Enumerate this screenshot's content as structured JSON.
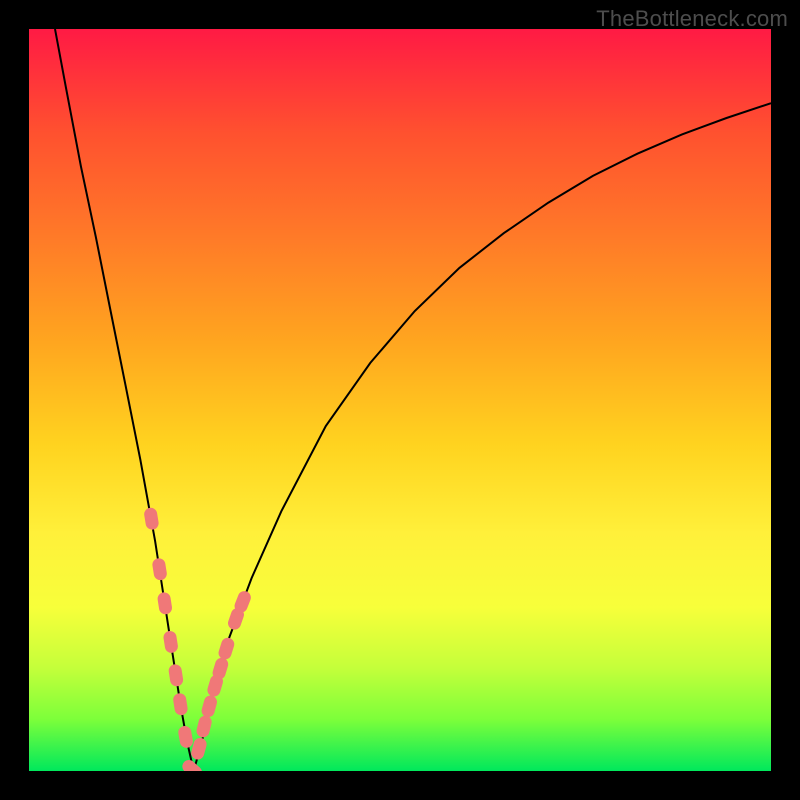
{
  "watermark": "TheBottleneck.com",
  "chart_data": {
    "type": "line",
    "title": "",
    "xlabel": "",
    "ylabel": "",
    "xlim": [
      0,
      100
    ],
    "ylim": [
      0,
      100
    ],
    "x_minimum": 22.2,
    "curve": {
      "x": [
        3.5,
        5,
        7,
        9,
        11,
        13,
        15,
        17,
        19,
        20.4,
        21.3,
        22.2,
        23.3,
        25,
        27,
        30,
        34,
        40,
        46,
        52,
        58,
        64,
        70,
        76,
        82,
        88,
        94,
        100
      ],
      "y": [
        100,
        92,
        81.5,
        72,
        62,
        52,
        42,
        31,
        18,
        9,
        4,
        0,
        4,
        11,
        18,
        26,
        35,
        46.5,
        55,
        62,
        67.8,
        72.5,
        76.6,
        80.2,
        83.2,
        85.8,
        88,
        90
      ]
    },
    "markers": {
      "x": [
        16.5,
        17.6,
        18.3,
        19.1,
        19.8,
        20.4,
        21.1,
        22.0,
        22.9,
        23.6,
        24.3,
        25.1,
        25.8,
        26.6,
        27.9,
        28.8
      ],
      "y": [
        34.0,
        27.2,
        22.6,
        17.4,
        12.9,
        9.0,
        4.6,
        0.2,
        3.0,
        6.0,
        8.7,
        11.5,
        13.8,
        16.5,
        20.5,
        22.8
      ]
    },
    "gradient_stops": [
      {
        "pos": 0,
        "color": "#ff1a44"
      },
      {
        "pos": 14,
        "color": "#ff512f"
      },
      {
        "pos": 28,
        "color": "#ff7a28"
      },
      {
        "pos": 42,
        "color": "#ffa51f"
      },
      {
        "pos": 56,
        "color": "#ffd31f"
      },
      {
        "pos": 68,
        "color": "#fff03a"
      },
      {
        "pos": 78,
        "color": "#f7ff3a"
      },
      {
        "pos": 86,
        "color": "#c5ff3a"
      },
      {
        "pos": 93,
        "color": "#7dff3a"
      },
      {
        "pos": 100,
        "color": "#00e85c"
      }
    ]
  }
}
